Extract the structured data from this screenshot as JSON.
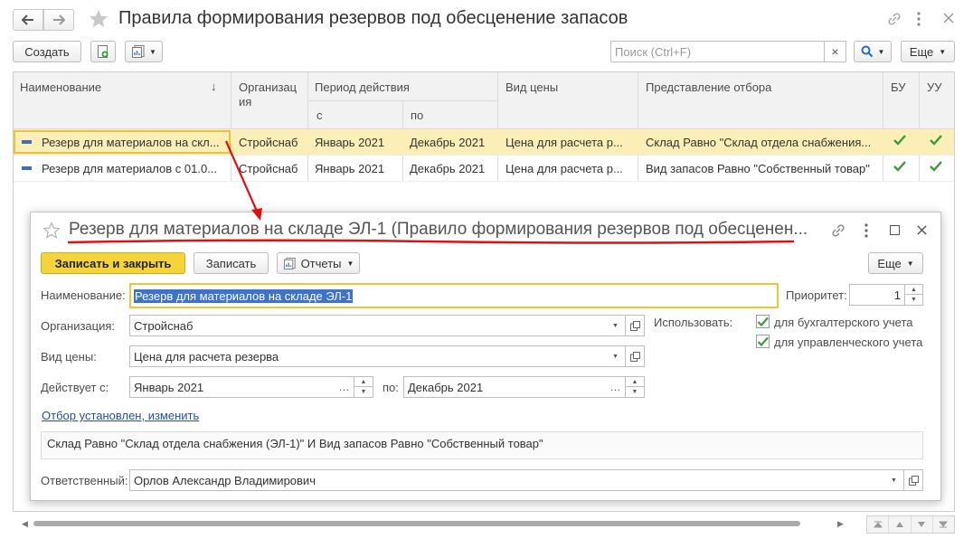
{
  "window": {
    "title": "Правила формирования резервов под обесценение запасов"
  },
  "toolbar": {
    "create_label": "Создать",
    "search_placeholder": "Поиск (Ctrl+F)",
    "clear_symbol": "×",
    "more_label": "Еще"
  },
  "table": {
    "headers": {
      "name": "Наименование",
      "sort_symbol": "↓",
      "org": "Организац ия",
      "period": "Период действия",
      "period_from": "с",
      "period_to": "по",
      "price_type": "Вид цены",
      "filter": "Представление отбора",
      "bu": "БУ",
      "uu": "УУ"
    },
    "rows": [
      {
        "name": "Резерв для материалов на скл...",
        "org": "Стройснаб",
        "from": "Январь 2021",
        "to": "Декабрь 2021",
        "price_type": "Цена для расчета р...",
        "filter": "Склад Равно \"Склад отдела снабжения...",
        "bu": true,
        "uu": true
      },
      {
        "name": "Резерв для материалов с 01.0...",
        "org": "Стройснаб",
        "from": "Январь 2021",
        "to": "Декабрь 2021",
        "price_type": "Цена для расчета р...",
        "filter": "Вид запасов Равно \"Собственный товар\"",
        "bu": true,
        "uu": true
      }
    ]
  },
  "dialog": {
    "title": "Резерв для материалов на складе ЭЛ-1 (Правило формирования резервов под обесценен...",
    "save_close_label": "Записать и закрыть",
    "save_label": "Записать",
    "reports_label": "Отчеты",
    "more_label": "Еще",
    "name_label": "Наименование:",
    "name_value": "Резерв для материалов на складе ЭЛ-1",
    "priority_label": "Приоритет:",
    "priority_value": "1",
    "org_label": "Организация:",
    "org_value": "Стройснаб",
    "price_label": "Вид цены:",
    "price_value": "Цена для расчета резерва",
    "valid_from_label": "Действует с:",
    "valid_from_value": "Январь 2021",
    "to_label": "по:",
    "valid_to_value": "Декабрь 2021",
    "use_label": "Использовать:",
    "use_bu_label": "для бухгалтерского учета",
    "use_uu_label": "для управленческого учета",
    "use_bu_checked": true,
    "use_uu_checked": true,
    "filter_link": "Отбор установлен, изменить",
    "filter_text": "Склад Равно \"Склад отдела снабжения (ЭЛ-1)\" И Вид запасов Равно \"Собственный товар\"",
    "responsible_label": "Ответственный:",
    "responsible_value": "Орлов Александр Владимирович"
  },
  "colors": {
    "accent_yellow": "#f5d33b",
    "selected_row": "#fbeeb6",
    "check_green": "#3a9a3a",
    "annotation_red": "#e01010"
  }
}
